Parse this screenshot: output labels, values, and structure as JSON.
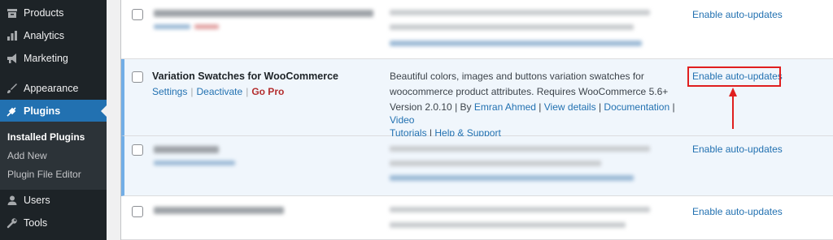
{
  "sidebar": {
    "items": [
      {
        "label": "Products",
        "icon": "archive-icon"
      },
      {
        "label": "Analytics",
        "icon": "chart-bar-icon"
      },
      {
        "label": "Marketing",
        "icon": "megaphone-icon"
      },
      {
        "label": "Appearance",
        "icon": "paintbrush-icon"
      },
      {
        "label": "Plugins",
        "icon": "plugin-icon"
      },
      {
        "label": "Users",
        "icon": "user-icon"
      },
      {
        "label": "Tools",
        "icon": "wrench-icon"
      }
    ],
    "submenu": [
      "Installed Plugins",
      "Add New",
      "Plugin File Editor"
    ]
  },
  "plugin": {
    "title": "Variation Swatches for WooCommerce",
    "actions": {
      "settings": "Settings",
      "deactivate": "Deactivate",
      "gopro": "Go Pro",
      "sep": "|"
    },
    "description_line1": "Beautiful colors, images and buttons variation swatches for",
    "description_line2": "woocommerce product attributes. Requires WooCommerce 5.6+",
    "version": "Version 2.0.10",
    "by": "By",
    "author": "Emran Ahmed",
    "view_details": "View details",
    "documentation": "Documentation",
    "video_tutorials_1": "Video",
    "video_tutorials_2": "Tutorials",
    "help": "Help & Support",
    "sep": "|"
  },
  "auto_update_label": "Enable auto-updates",
  "colors": {
    "accent": "#2271b1",
    "highlight": "#e01f1f",
    "sidebar": "#1d2327",
    "gopro": "#b32d2e"
  }
}
